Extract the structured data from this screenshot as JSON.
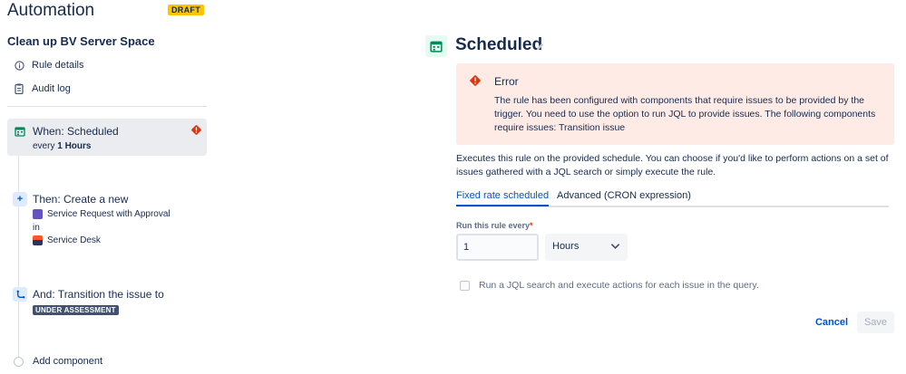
{
  "app": {
    "title": "Automation",
    "status_badge": "DRAFT"
  },
  "rule": {
    "name": "Clean up BV Server Space",
    "links": [
      {
        "label": "Rule details",
        "icon": "info-icon"
      },
      {
        "label": "Audit log",
        "icon": "clipboard-icon"
      }
    ]
  },
  "steps": {
    "trigger": {
      "title": "When: Scheduled",
      "sub_prefix": "every",
      "sub_value": "1 Hours",
      "icon": "calendar-icon",
      "has_error": true
    },
    "action": {
      "title": "Then: Create a new",
      "issue_type": "Service Request with Approval",
      "connector": "in",
      "project": "Service Desk",
      "icon": "plus-icon"
    },
    "transition": {
      "title": "And: Transition the issue to",
      "status": "UNDER ASSESSMENT",
      "icon": "branch-icon"
    },
    "add": {
      "label": "Add component"
    }
  },
  "panel": {
    "title": "Scheduled",
    "error": {
      "title": "Error",
      "body": "The rule has been configured with components that require issues to be provided by the trigger. You need to use the option to run JQL to provide issues. The following components require issues: Transition issue"
    },
    "description": "Executes this rule on the provided schedule. You can choose if you'd like to perform actions on a set of issues gathered with a JQL search or simply execute the rule.",
    "tabs": [
      {
        "label": "Fixed rate scheduled",
        "active": true
      },
      {
        "label": "Advanced (CRON expression)",
        "active": false
      }
    ],
    "interval": {
      "label": "Run this rule every",
      "required_mark": "*",
      "value": "1",
      "unit": "Hours"
    },
    "jql_checkbox": {
      "label": "Run a JQL search and execute actions for each issue in the query.",
      "checked": false
    },
    "buttons": {
      "cancel": "Cancel",
      "save": "Save"
    }
  },
  "colors": {
    "accent": "#0052cc",
    "error_bg": "#ffebe6",
    "error_icon": "#de350b",
    "draft_badge": "#ffc400",
    "lozenge": "#42526e",
    "schedule_icon": "#00875a"
  }
}
